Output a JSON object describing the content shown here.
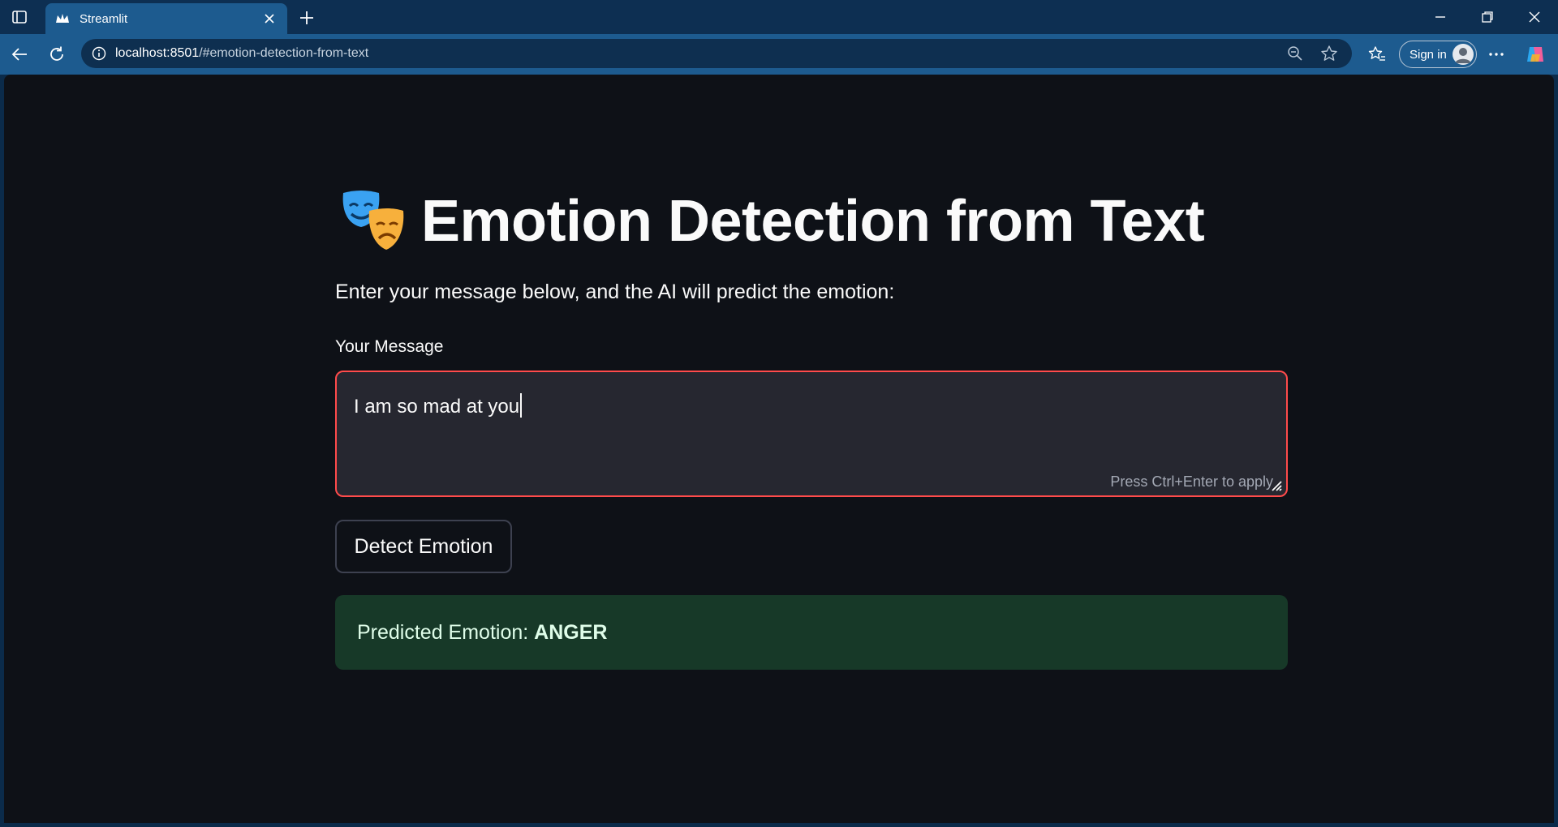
{
  "browser": {
    "tab_title": "Streamlit",
    "url_host": "localhost:8501",
    "url_path": "/#emotion-detection-from-text",
    "signin_label": "Sign in"
  },
  "page": {
    "title": "Emotion Detection from Text",
    "subtitle": "Enter your message below, and the AI will predict the emotion:",
    "input": {
      "label": "Your Message",
      "value": "I am so mad at you",
      "hint": "Press Ctrl+Enter to apply"
    },
    "button_label": "Detect Emotion",
    "result": {
      "prefix": "Predicted Emotion: ",
      "emotion": "ANGER"
    }
  },
  "colors": {
    "page_bg": "#0e1117",
    "accent_border": "#ff4b4b",
    "success_bg": "#173928",
    "chrome": "#1d5b8f"
  }
}
